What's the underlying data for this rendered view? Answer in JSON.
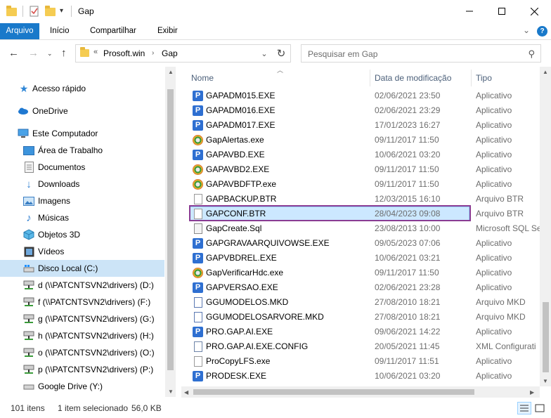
{
  "window": {
    "title": "Gap"
  },
  "ribbon": {
    "tabs": [
      "Arquivo",
      "Início",
      "Compartilhar",
      "Exibir"
    ]
  },
  "address": {
    "segments": [
      "Prosoft.win",
      "Gap"
    ]
  },
  "search": {
    "placeholder": "Pesquisar em Gap"
  },
  "nav": {
    "items": [
      {
        "label": "Acesso rápido",
        "icon": "star-icon"
      },
      {
        "label": "OneDrive",
        "icon": "cloud-icon"
      },
      {
        "label": "Este Computador",
        "icon": "computer-icon"
      },
      {
        "label": "Área de Trabalho",
        "icon": "desktop-icon"
      },
      {
        "label": "Documentos",
        "icon": "document-icon"
      },
      {
        "label": "Downloads",
        "icon": "download-icon"
      },
      {
        "label": "Imagens",
        "icon": "image-icon"
      },
      {
        "label": "Músicas",
        "icon": "music-icon"
      },
      {
        "label": "Objetos 3D",
        "icon": "cube-icon"
      },
      {
        "label": "Vídeos",
        "icon": "video-icon"
      },
      {
        "label": "Disco Local (C:)",
        "icon": "drive-icon"
      },
      {
        "label": "d (\\\\PATCNTSVN2\\drivers) (D:)",
        "icon": "network-drive-icon"
      },
      {
        "label": "f (\\\\PATCNTSVN2\\drivers) (F:)",
        "icon": "network-drive-icon"
      },
      {
        "label": "g (\\\\PATCNTSVN2\\drivers) (G:)",
        "icon": "network-drive-icon"
      },
      {
        "label": "h (\\\\PATCNTSVN2\\drivers) (H:)",
        "icon": "network-drive-icon"
      },
      {
        "label": "o (\\\\PATCNTSVN2\\drivers) (O:)",
        "icon": "network-drive-icon"
      },
      {
        "label": "p (\\\\PATCNTSVN2\\drivers) (P:)",
        "icon": "network-drive-icon"
      },
      {
        "label": "Google Drive (Y:)",
        "icon": "drive-icon"
      }
    ]
  },
  "columns": {
    "name": "Nome",
    "date": "Data de modificação",
    "type": "Tipo"
  },
  "files": [
    {
      "name": "GAPADM015.EXE",
      "date": "02/06/2021 23:50",
      "type": "Aplicativo",
      "icon": "exe"
    },
    {
      "name": "GAPADM016.EXE",
      "date": "02/06/2021 23:29",
      "type": "Aplicativo",
      "icon": "exe"
    },
    {
      "name": "GAPADM017.EXE",
      "date": "17/01/2023 16:27",
      "type": "Aplicativo",
      "icon": "exe"
    },
    {
      "name": "GapAlertas.exe",
      "date": "09/11/2017 11:50",
      "type": "Aplicativo",
      "icon": "gear"
    },
    {
      "name": "GAPAVBD.EXE",
      "date": "10/06/2021 03:20",
      "type": "Aplicativo",
      "icon": "exe"
    },
    {
      "name": "GAPAVBD2.EXE",
      "date": "09/11/2017 11:50",
      "type": "Aplicativo",
      "icon": "gear"
    },
    {
      "name": "GAPAVBDFTP.exe",
      "date": "09/11/2017 11:50",
      "type": "Aplicativo",
      "icon": "gear"
    },
    {
      "name": "GAPBACKUP.BTR",
      "date": "12/03/2015 16:10",
      "type": "Arquivo BTR",
      "icon": "doc"
    },
    {
      "name": "GAPCONF.BTR",
      "date": "28/04/2023 09:08",
      "type": "Arquivo BTR",
      "icon": "doc",
      "selected": true
    },
    {
      "name": "GapCreate.Sql",
      "date": "23/08/2013 10:00",
      "type": "Microsoft SQL Se",
      "icon": "sql"
    },
    {
      "name": "GAPGRAVAARQUIVOWSE.EXE",
      "date": "09/05/2023 07:06",
      "type": "Aplicativo",
      "icon": "exe"
    },
    {
      "name": "GAPVBDREL.EXE",
      "date": "10/06/2021 03:21",
      "type": "Aplicativo",
      "icon": "exe"
    },
    {
      "name": "GapVerificarHdc.exe",
      "date": "09/11/2017 11:50",
      "type": "Aplicativo",
      "icon": "gear"
    },
    {
      "name": "GAPVERSAO.EXE",
      "date": "02/06/2021 23:28",
      "type": "Aplicativo",
      "icon": "exe"
    },
    {
      "name": "GGUMODELOS.MKD",
      "date": "27/08/2010 18:21",
      "type": "Arquivo MKD",
      "icon": "mkd"
    },
    {
      "name": "GGUMODELOSARVORE.MKD",
      "date": "27/08/2010 18:21",
      "type": "Arquivo MKD",
      "icon": "mkd"
    },
    {
      "name": "PRO.GAP.AI.EXE",
      "date": "09/06/2021 14:22",
      "type": "Aplicativo",
      "icon": "exe"
    },
    {
      "name": "PRO.GAP.AI.EXE.CONFIG",
      "date": "20/05/2021 11:45",
      "type": "XML Configurati",
      "icon": "cfg"
    },
    {
      "name": "ProCopyLFS.exe",
      "date": "09/11/2017 11:51",
      "type": "Aplicativo",
      "icon": "doc"
    },
    {
      "name": "PRODESK.EXE",
      "date": "10/06/2021 03:20",
      "type": "Aplicativo",
      "icon": "exe"
    }
  ],
  "status": {
    "count": "101 itens",
    "selection": "1 item selecionado",
    "size": "56,0 KB"
  },
  "colors": {
    "accent": "#1979ca",
    "selection": "#cce8ff",
    "highlight_outline": "#8a3c93"
  }
}
